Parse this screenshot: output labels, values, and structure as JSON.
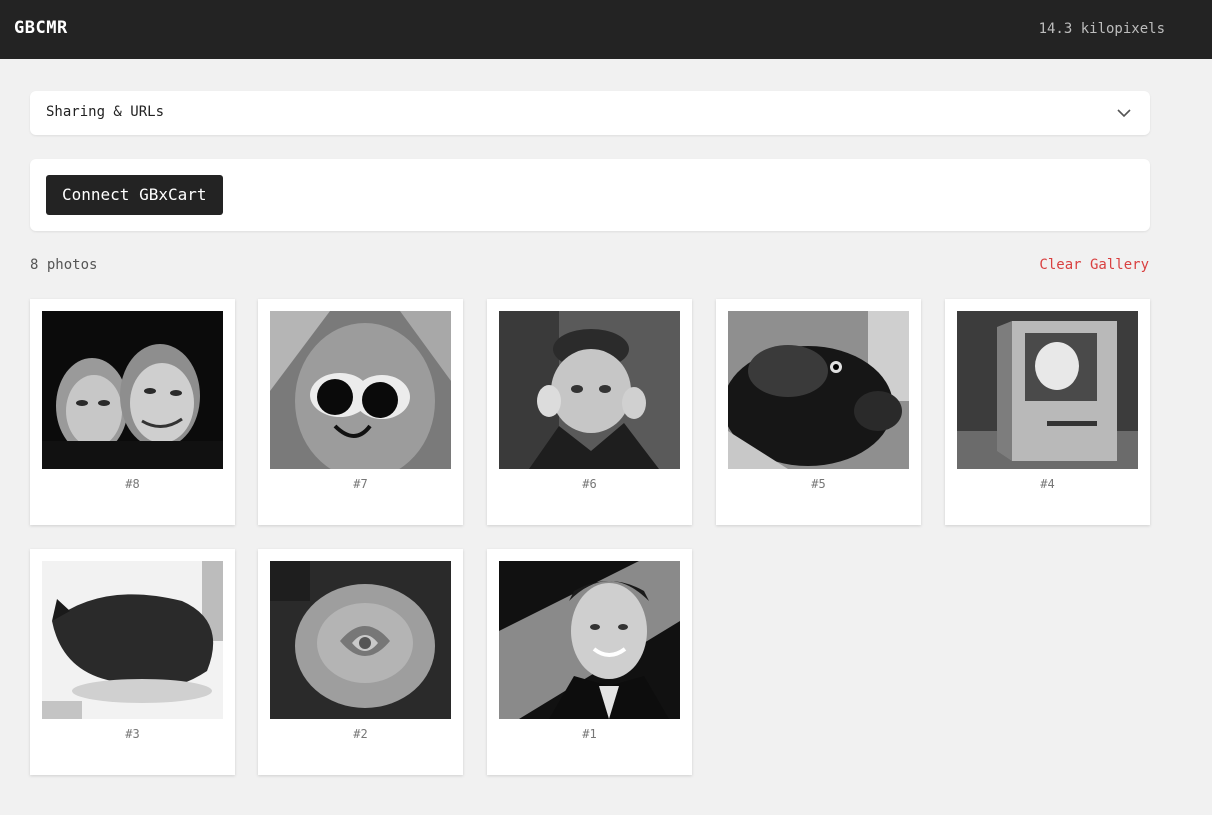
{
  "header": {
    "title": "GBCMR",
    "status": "14.3 kilopixels"
  },
  "sharing": {
    "label": "Sharing & URLs",
    "icon": "chevron-down-icon"
  },
  "connect": {
    "label": "Connect GBxCart"
  },
  "gallery": {
    "count_label": "8 photos",
    "clear_label": "Clear Gallery",
    "clear_color": "#d94040",
    "photos": [
      {
        "label": "#8",
        "subject": "couple"
      },
      {
        "label": "#7",
        "subject": "googly-eyes"
      },
      {
        "label": "#6",
        "subject": "child"
      },
      {
        "label": "#5",
        "subject": "pig"
      },
      {
        "label": "#4",
        "subject": "computer"
      },
      {
        "label": "#3",
        "subject": "cat"
      },
      {
        "label": "#2",
        "subject": "rose"
      },
      {
        "label": "#1",
        "subject": "man"
      }
    ]
  }
}
